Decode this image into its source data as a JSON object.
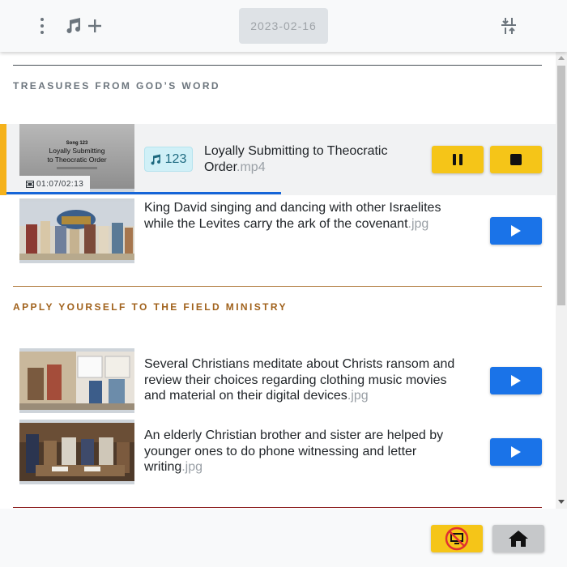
{
  "header": {
    "date": "2023-02-16",
    "menu_icon": "kebab-vertical-icon",
    "music_icon": "music-note-icon",
    "add_icon": "plus-icon",
    "sort_icon": "sort-arrows-icon"
  },
  "sections": [
    {
      "title": "TREASURES FROM GOD’S WORD",
      "color": "#6c757d",
      "line_color": "#495057"
    },
    {
      "title": "APPLY YOURSELF TO THE FIELD MINISTRY",
      "color": "#a0611b",
      "line_color": "#b07a3c"
    },
    {
      "title": "",
      "color": "#8b1c1c",
      "line_color": "#8b1c1c"
    }
  ],
  "media": [
    {
      "section": 0,
      "status": "playing",
      "title": "Loyally Submitting to Theocratic Order",
      "ext": ".mp4",
      "song_number": "123",
      "timecode": "01:07/02:13",
      "progress": 0.5,
      "thumbnail_caption": "Song 123\nLoyally Submitting\nto Theocratic Order",
      "buttons": {
        "pause_icon": "pause-icon",
        "stop_icon": "stop-icon"
      }
    },
    {
      "section": 0,
      "status": "idle",
      "title": "King David singing and dancing with other Israelites while the Levites carry the ark of the covenant",
      "ext": ".jpg",
      "buttons": {
        "play_icon": "play-icon"
      }
    },
    {
      "section": 1,
      "status": "idle",
      "title": "Several Christians meditate about Christs ransom and review their choices regarding clothing music movies and material on their digital devices",
      "ext": ".jpg",
      "buttons": {
        "play_icon": "play-icon"
      }
    },
    {
      "section": 1,
      "status": "idle",
      "title": "An elderly Christian brother and sister are helped by younger ones to do phone witnessing and letter writing",
      "ext": ".jpg",
      "buttons": {
        "play_icon": "play-icon"
      }
    }
  ],
  "footer": {
    "presentation_icon": "presentation-off-icon",
    "home_icon": "home-icon"
  },
  "colors": {
    "accent_yellow": "#f5c518",
    "play_blue": "#1a73e8",
    "progress_blue": "#1565d8"
  }
}
